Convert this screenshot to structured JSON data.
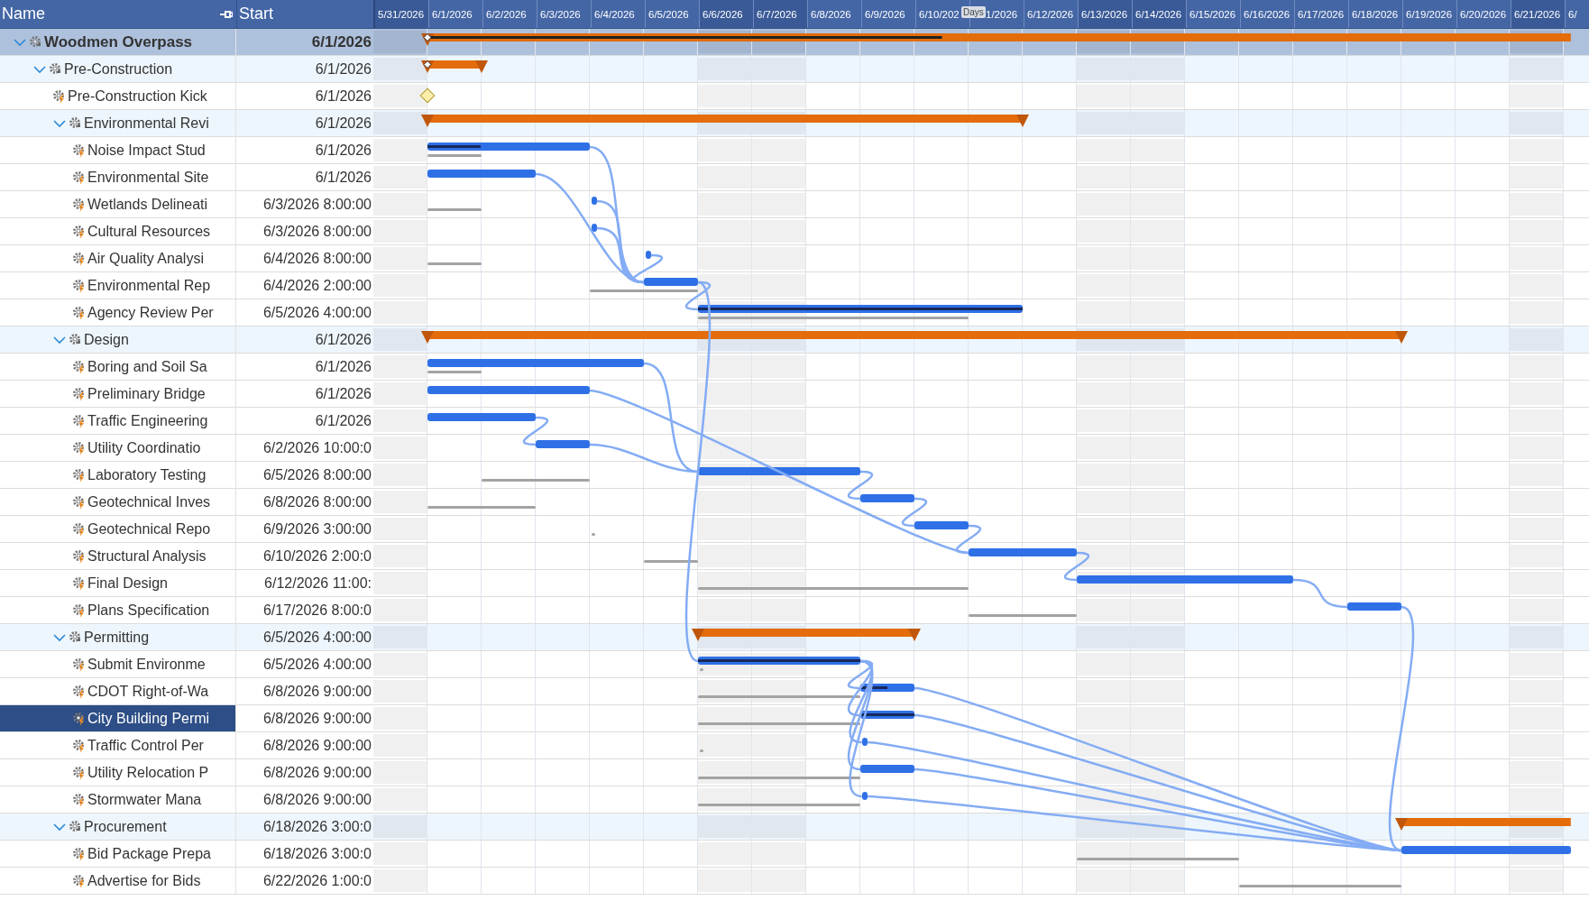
{
  "columns": {
    "name": "Name",
    "start": "Start"
  },
  "timeline": {
    "dates": [
      {
        "label": "5/31/2026",
        "weekend": true
      },
      {
        "label": "6/1/2026",
        "weekend": false
      },
      {
        "label": "6/2/2026",
        "weekend": false
      },
      {
        "label": "6/3/2026",
        "weekend": false
      },
      {
        "label": "6/4/2026",
        "weekend": false
      },
      {
        "label": "6/5/2026",
        "weekend": false
      },
      {
        "label": "6/6/2026",
        "weekend": true
      },
      {
        "label": "6/7/2026",
        "weekend": true
      },
      {
        "label": "6/8/2026",
        "weekend": false
      },
      {
        "label": "6/9/2026",
        "weekend": false
      },
      {
        "label": "6/10/202",
        "weekend": false
      },
      {
        "label": "1/2026",
        "weekend": false,
        "tooltip": "Days"
      },
      {
        "label": "6/12/2026",
        "weekend": false
      },
      {
        "label": "6/13/2026",
        "weekend": true
      },
      {
        "label": "6/14/2026",
        "weekend": true
      },
      {
        "label": "6/15/2026",
        "weekend": false
      },
      {
        "label": "6/16/2026",
        "weekend": false
      },
      {
        "label": "6/17/2026",
        "weekend": false
      },
      {
        "label": "6/18/2026",
        "weekend": false
      },
      {
        "label": "6/19/2026",
        "weekend": false
      },
      {
        "label": "6/20/2026",
        "weekend": false
      },
      {
        "label": "6/21/2026",
        "weekend": true
      },
      {
        "label": "6/",
        "weekend": false
      }
    ]
  },
  "tasks": [
    {
      "name": "Woodmen Overpass",
      "start": "6/1/2026",
      "kind": "project",
      "expanded": true,
      "selected": false,
      "marker": true,
      "level": 0.45,
      "children": [
        {
          "name": "Pre-Construction",
          "start": "6/1/2026",
          "kind": "summary",
          "expanded": true,
          "selected": false,
          "marker": true,
          "children": [
            {
              "name": "Pre-Construction Kick",
              "start": "6/1/2026",
              "kind": "milestone",
              "selected": false
            },
            {
              "name": "Environmental Revi",
              "start": "6/1/2026",
              "kind": "summary",
              "expanded": true,
              "selected": false,
              "children": [
                {
                  "name": "Noise Impact Stud",
                  "start": "6/1/2026",
                  "kind": "task",
                  "selected": false,
                  "level": 0.33
                },
                {
                  "name": "Environmental Site",
                  "start": "6/1/2026",
                  "kind": "task",
                  "selected": false
                },
                {
                  "name": "Wetlands Delineati",
                  "start": "6/3/2026 8:00:00",
                  "kind": "task",
                  "selected": false
                },
                {
                  "name": "Cultural Resources",
                  "start": "6/3/2026 8:00:00",
                  "kind": "task",
                  "selected": false
                },
                {
                  "name": "Air Quality Analysi",
                  "start": "6/4/2026 8:00:00",
                  "kind": "task",
                  "selected": false
                },
                {
                  "name": "Environmental Rep",
                  "start": "6/4/2026 2:00:00",
                  "kind": "task",
                  "selected": false
                },
                {
                  "name": "Agency Review Per",
                  "start": "6/5/2026 4:00:00",
                  "kind": "task",
                  "selected": false,
                  "level": 1
                }
              ]
            },
            {
              "name": "Design",
              "start": "6/1/2026",
              "kind": "summary",
              "expanded": true,
              "selected": false,
              "children": [
                {
                  "name": "Boring and Soil Sa",
                  "start": "6/1/2026",
                  "kind": "task",
                  "selected": false
                },
                {
                  "name": "Preliminary Bridge",
                  "start": "6/1/2026",
                  "kind": "task",
                  "selected": false
                },
                {
                  "name": "Traffic Engineering",
                  "start": "6/1/2026",
                  "kind": "task",
                  "selected": false
                },
                {
                  "name": "Utility Coordinatio",
                  "start": "6/2/2026 10:00:0",
                  "kind": "task",
                  "selected": false
                },
                {
                  "name": "Laboratory Testing",
                  "start": "6/5/2026 8:00:00",
                  "kind": "task",
                  "selected": false
                },
                {
                  "name": "Geotechnical Inves",
                  "start": "6/8/2026 8:00:00",
                  "kind": "task",
                  "selected": false
                },
                {
                  "name": "Geotechnical Repo",
                  "start": "6/9/2026 3:00:00",
                  "kind": "task",
                  "selected": false
                },
                {
                  "name": "Structural Analysis",
                  "start": "6/10/2026 2:00:0",
                  "kind": "task",
                  "selected": false
                },
                {
                  "name": "Final Design",
                  "start": "6/12/2026 11:00:",
                  "kind": "task",
                  "selected": false
                },
                {
                  "name": "Plans Specification",
                  "start": "6/17/2026 8:00:0",
                  "kind": "task",
                  "selected": false
                }
              ]
            },
            {
              "name": "Permitting",
              "start": "6/5/2026 4:00:00",
              "kind": "summary",
              "expanded": true,
              "selected": false,
              "children": [
                {
                  "name": "Submit Environme",
                  "start": "6/5/2026 4:00:00",
                  "kind": "task",
                  "selected": false,
                  "level": 1
                },
                {
                  "name": "CDOT Right-of-Wa",
                  "start": "6/8/2026 9:00:00",
                  "kind": "task",
                  "selected": false,
                  "level": 0.5
                },
                {
                  "name": "City Building Permi",
                  "start": "6/8/2026 9:00:00",
                  "kind": "task",
                  "selected": true,
                  "level": 1
                },
                {
                  "name": "Traffic Control Per",
                  "start": "6/8/2026 9:00:00",
                  "kind": "task",
                  "selected": false
                },
                {
                  "name": "Utility Relocation P",
                  "start": "6/8/2026 9:00:00",
                  "kind": "task",
                  "selected": false
                },
                {
                  "name": "Stormwater Mana",
                  "start": "6/8/2026 9:00:00",
                  "kind": "task",
                  "selected": false
                }
              ]
            },
            {
              "name": "Procurement",
              "start": "6/18/2026 3:00:0",
              "kind": "summary",
              "expanded": true,
              "selected": false,
              "children": [
                {
                  "name": "Bid Package Prepa",
                  "start": "6/18/2026 3:00:0",
                  "kind": "task",
                  "selected": false
                },
                {
                  "name": "Advertise for Bids",
                  "start": "6/22/2026 1:00:0",
                  "kind": "task",
                  "selected": false
                }
              ]
            }
          ]
        }
      ]
    }
  ]
}
